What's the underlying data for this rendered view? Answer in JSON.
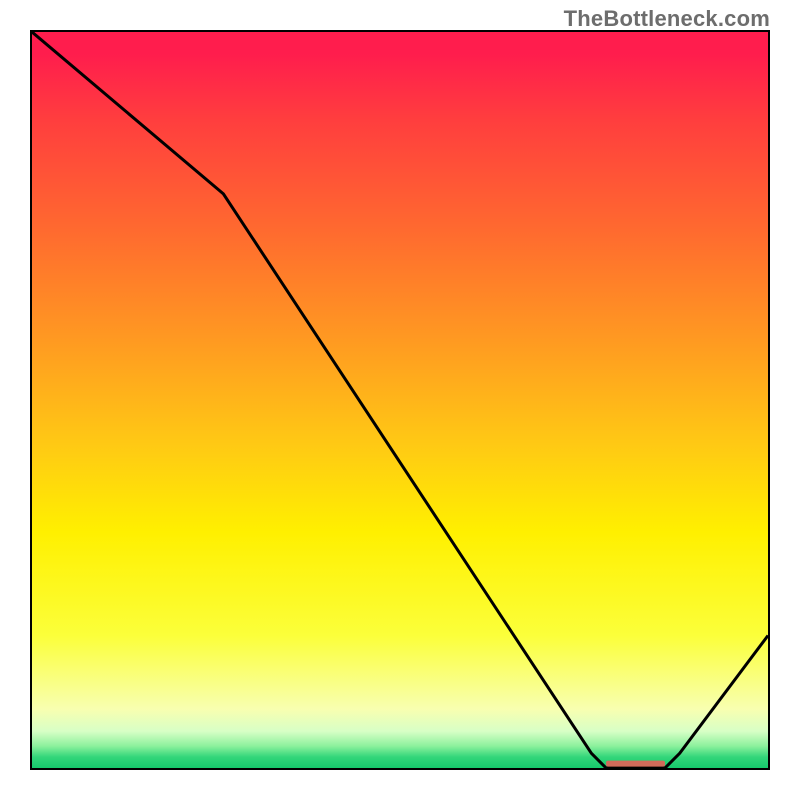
{
  "chart_data": {
    "type": "line",
    "title": "",
    "xlabel": "",
    "ylabel": "",
    "xlim": [
      0,
      100
    ],
    "ylim": [
      0,
      100
    ],
    "watermark": "TheBottleneck.com",
    "x": [
      0,
      26,
      76,
      78,
      86,
      88,
      100
    ],
    "values": [
      100,
      78,
      2,
      0,
      0,
      2,
      18
    ],
    "flat_region": {
      "x_start": 78,
      "x_end": 86,
      "y": 0.6
    },
    "colors": {
      "curve": "#000000",
      "marker": "#d26b5a",
      "gradient_top": "#ff1d4d",
      "gradient_bottom": "#16c96c"
    }
  }
}
